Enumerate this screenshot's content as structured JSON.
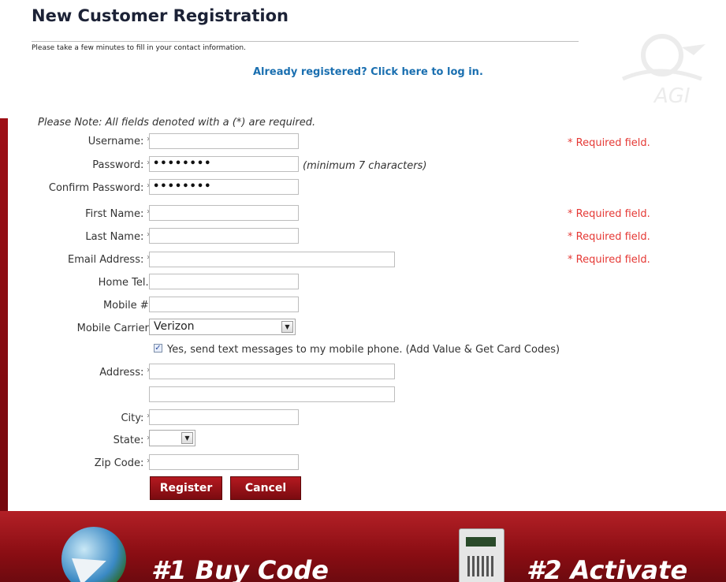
{
  "page": {
    "title": "New Customer Registration",
    "intro": "Please take a few minutes to fill in your contact information.",
    "login_link": "Already registered? Click here to log in.",
    "note": "Please Note: All fields denoted with a (*) are required."
  },
  "form": {
    "username_label": "Username:",
    "password_label": "Password:",
    "password_value": "••••••••",
    "password_hint": "(minimum 7 characters)",
    "confirm_label": "Confirm Password:",
    "confirm_value": "••••••••",
    "first_name_label": "First Name:",
    "last_name_label": "Last Name:",
    "email_label": "Email Address:",
    "home_tel_label": "Home Tel.:",
    "mobile_label": "Mobile #:",
    "carrier_label": "Mobile Carrier:",
    "carrier_value": "Verizon",
    "sms_opt_in": "Yes, send text messages to my mobile phone. (Add Value & Get Card Codes)",
    "address_label": "Address:",
    "city_label": "City:",
    "state_label": "State:",
    "state_value": "",
    "zip_label": "Zip Code:",
    "required_star": "*",
    "required_field": "* Required field."
  },
  "buttons": {
    "register": "Register",
    "cancel": "Cancel"
  },
  "footer": {
    "step1": "#1 Buy Code",
    "step2": "#2 Activate"
  },
  "colors": {
    "accent_red": "#9e0f16",
    "link_blue": "#1a6fb0",
    "error_red": "#e53935"
  }
}
